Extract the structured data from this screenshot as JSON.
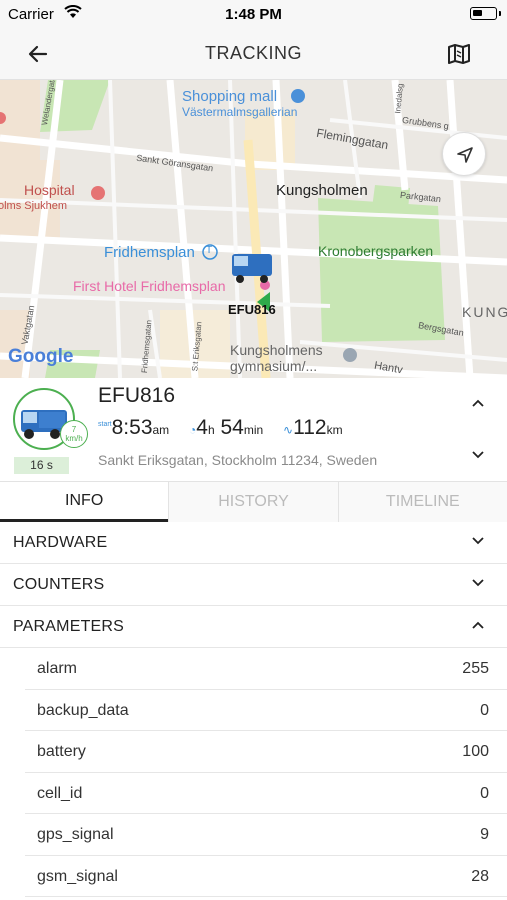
{
  "status_bar": {
    "carrier": "Carrier",
    "time": "1:48 PM"
  },
  "navbar": {
    "title": "TRACKING"
  },
  "map": {
    "labels": {
      "shopping_mall": "Shopping mall",
      "vastermalmsgallerian": "Västermalmsgallerian",
      "fleminggatan": "Fleminggatan",
      "grubbens": "Grubbens g",
      "sankt_goransgatan": "Sankt Göransgatan",
      "hospital": "Hospital",
      "sjukhem": "olms Sjukhem",
      "kungsholmen": "Kungsholmen",
      "parkgatan": "Parkgatan",
      "fridhemsplan": "Fridhemsplan",
      "kronobergsparken": "Kronobergsparken",
      "first_hotel": "First Hotel Fridhemsplan",
      "vehicle_label": "EFU816",
      "kung": "KUNG",
      "bergsgatan": "Bergsgatan",
      "kungsholmens_gymnasium_1": "Kungsholmens",
      "kungsholmens_gymnasium_2": "gymnasium/...",
      "hantv": "Hantv",
      "welandergatan": "Welandergatan",
      "inedalsgatan": "Inedalsg",
      "fridhemsgatan": "Fridhemsgatan",
      "st_eriksgatan": "S:t Eriksgatan",
      "vaktgatan": "Vaktgatan",
      "google": "Google",
      "tbana": "T"
    }
  },
  "vehicle": {
    "plate": "EFU816",
    "speed_value": "7",
    "speed_unit": "km/h",
    "elapsed": "16 s",
    "start_label": "start",
    "start_time": "8:53",
    "start_suffix": "am",
    "duration_h": "4",
    "duration_h_unit": "h",
    "duration_m": "54",
    "duration_m_unit": "min",
    "distance": "112",
    "distance_unit": "km",
    "address": "Sankt Eriksgatan, Stockholm 11234, Sweden"
  },
  "tabs": [
    {
      "label": "INFO",
      "active": true
    },
    {
      "label": "HISTORY",
      "active": false
    },
    {
      "label": "TIMELINE",
      "active": false
    }
  ],
  "sections": {
    "hardware": "HARDWARE",
    "counters": "COUNTERS",
    "parameters": "PARAMETERS"
  },
  "parameters": [
    {
      "name": "alarm",
      "value": "255"
    },
    {
      "name": "backup_data",
      "value": "0"
    },
    {
      "name": "battery",
      "value": "100"
    },
    {
      "name": "cell_id",
      "value": "0"
    },
    {
      "name": "gps_signal",
      "value": "9"
    },
    {
      "name": "gsm_signal",
      "value": "28"
    }
  ],
  "colors": {
    "accent_green": "#4caf50",
    "accent_blue": "#3a8fd8",
    "park_green": "#c8e6b4",
    "hotel_pink": "#e86aa8"
  },
  "icons": [
    "back-arrow-icon",
    "map-icon",
    "locate-icon",
    "chevron-up-icon",
    "chevron-down-icon",
    "truck-icon",
    "wifi-icon",
    "clock-icon",
    "route-icon"
  ]
}
